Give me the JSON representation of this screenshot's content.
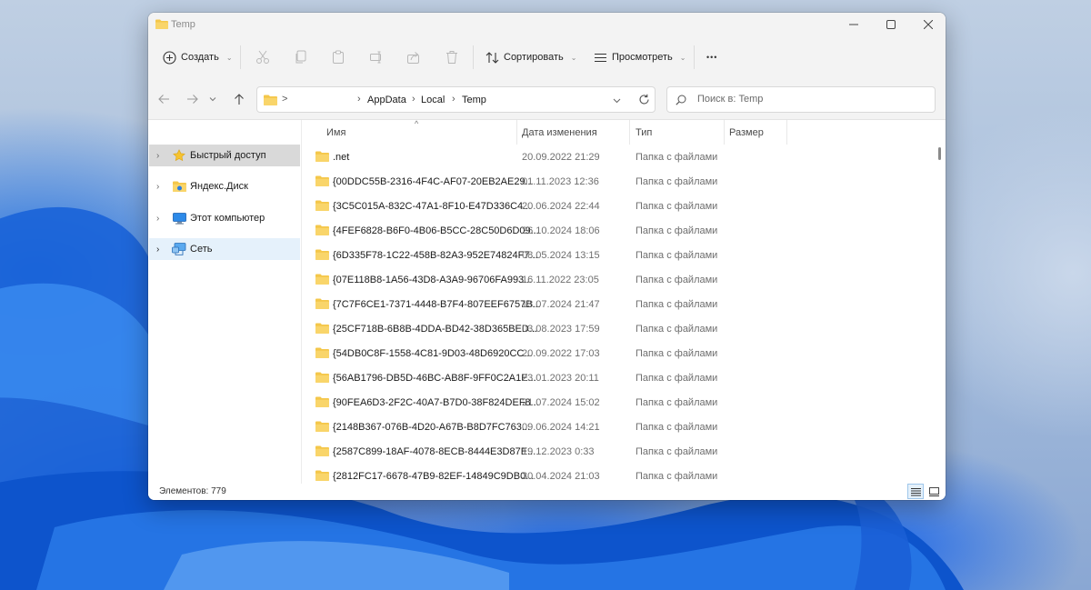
{
  "window": {
    "title": "Temp"
  },
  "toolbar": {
    "create_label": "Создать",
    "sort_label": "Сортировать",
    "view_label": "Просмотреть",
    "more_label": "•••"
  },
  "address": {
    "root_chevron": ">",
    "crumbs": [
      "AppData",
      "Local",
      "Temp"
    ]
  },
  "search": {
    "placeholder": "Поиск в: Temp"
  },
  "nav": {
    "items": [
      {
        "label": "Быстрый доступ",
        "icon": "star-icon"
      },
      {
        "label": "Яндекс.Диск",
        "icon": "yandex-disk-icon"
      },
      {
        "label": "Этот компьютер",
        "icon": "computer-icon"
      },
      {
        "label": "Сеть",
        "icon": "network-icon"
      }
    ]
  },
  "columns": {
    "name": "Имя",
    "date": "Дата изменения",
    "type": "Тип",
    "size": "Размер"
  },
  "files": [
    {
      "name": ".net",
      "date": "20.09.2022 21:29",
      "type": "Папка с файлами"
    },
    {
      "name": "{00DDC55B-2316-4F4C-AF07-20EB2AE29...",
      "date": "01.11.2023 12:36",
      "type": "Папка с файлами"
    },
    {
      "name": "{3C5C015A-832C-47A1-8F10-E47D336C4...",
      "date": "20.06.2024 22:44",
      "type": "Папка с файлами"
    },
    {
      "name": "{4FEF6828-B6F0-4B06-B5CC-28C50D6D09...",
      "date": "26.10.2024 18:06",
      "type": "Папка с файлами"
    },
    {
      "name": "{6D335F78-1C22-458B-82A3-952E74824F7...",
      "date": "08.05.2024 13:15",
      "type": "Папка с файлами"
    },
    {
      "name": "{07E118B8-1A56-43D8-A3A9-96706FA993...",
      "date": "16.11.2022 23:05",
      "type": "Папка с файлами"
    },
    {
      "name": "{7C7F6CE1-7371-4448-B7F4-807EEF6757B...",
      "date": "13.07.2024 21:47",
      "type": "Папка с файлами"
    },
    {
      "name": "{25CF718B-6B8B-4DDA-BD42-38D365BED...",
      "date": "03.08.2023 17:59",
      "type": "Папка с файлами"
    },
    {
      "name": "{54DB0C8F-1558-4C81-9D03-48D6920CC...",
      "date": "20.09.2022 17:03",
      "type": "Папка с файлами"
    },
    {
      "name": "{56AB1796-DB5D-46BC-AB8F-9FF0C2A1E...",
      "date": "23.01.2023 20:11",
      "type": "Папка с файлами"
    },
    {
      "name": "{90FEA6D3-2F2C-40A7-B7D0-38F824DEF8...",
      "date": "21.07.2024 15:02",
      "type": "Папка с файлами"
    },
    {
      "name": "{2148B367-076B-4D20-A67B-B8D7FC763...",
      "date": "09.06.2024 14:21",
      "type": "Папка с файлами"
    },
    {
      "name": "{2587C899-18AF-4078-8ECB-8444E3D87E...",
      "date": "19.12.2023 0:33",
      "type": "Папка с файлами"
    },
    {
      "name": "{2812FC17-6678-47B9-82EF-14849C9DB0...",
      "date": "30.04.2024 21:03",
      "type": "Папка с файлами"
    }
  ],
  "status": {
    "items_label": "Элементов: 779"
  },
  "colors": {
    "folder": "#f4c74a",
    "accent": "#0067c0",
    "selection": "#e5f1fb"
  }
}
